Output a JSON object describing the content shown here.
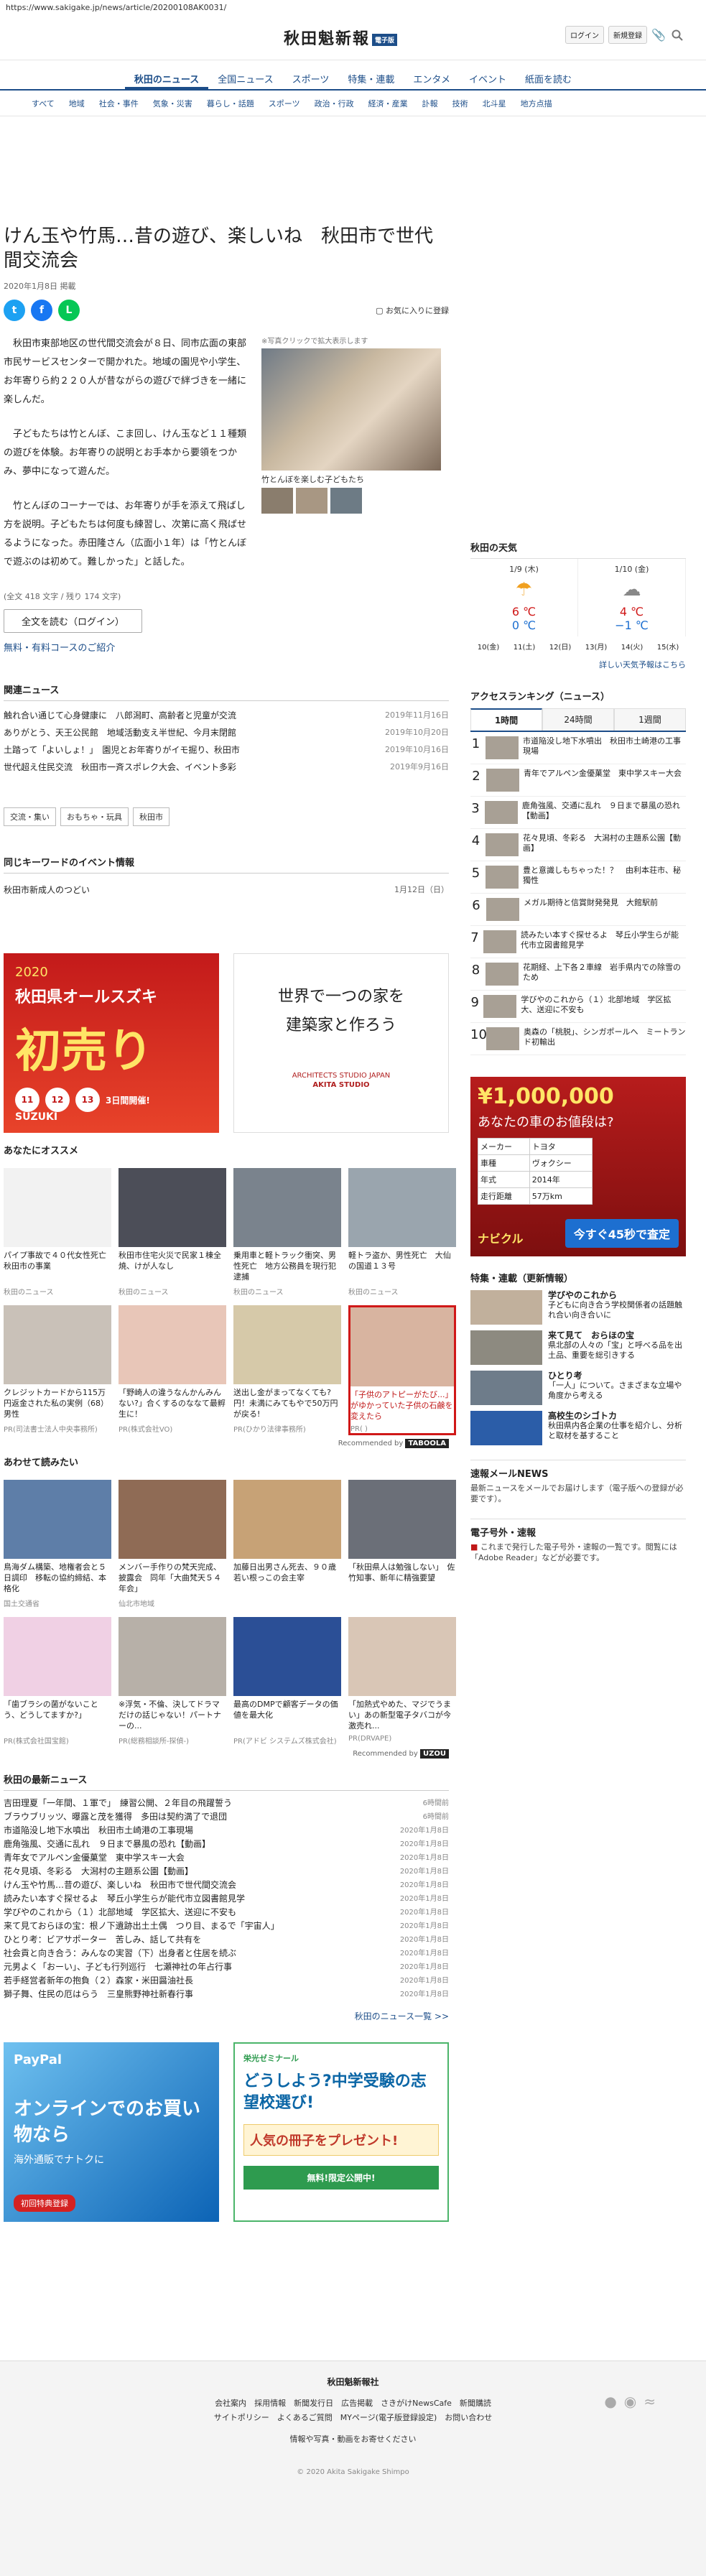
{
  "url": "https://www.sakigake.jp/news/article/20200108AK0031/",
  "header": {
    "logo": "秋田魁新報",
    "logo_badge": "電子版",
    "login": "ログイン",
    "register": "新規登録"
  },
  "nav_main": [
    "秋田のニュース",
    "全国ニュース",
    "スポーツ",
    "特集・連載",
    "エンタメ",
    "イベント",
    "紙面を読む"
  ],
  "nav_sub": [
    "すべて",
    "地域",
    "社会・事件",
    "気象・災害",
    "暮らし・話題",
    "スポーツ",
    "政治・行政",
    "経済・産業",
    "訃報",
    "技術",
    "北斗星",
    "地方点描"
  ],
  "article": {
    "title": "けん玉や竹馬…昔の遊び、楽しいね　秋田市で世代間交流会",
    "date": "2020年1月8日 掲載",
    "favorite": "お気に入りに登録",
    "photo_hint": "※写真クリックで拡大表示します",
    "photo_caption": "竹とんぼを楽しむ子どもたち",
    "paragraphs": [
      "秋田市東部地区の世代間交流会が８日、同市広面の東部市民サービスセンターで開かれた。地域の園児や小学生、お年寄りら約２２０人が昔ながらの遊びで絆づきを一緒に楽しんだ。",
      "子どもたちは竹とんぼ、こま回し、けん玉など１１種類の遊びを体験。お年寄りの説明とお手本から要領をつかみ、夢中になって遊んだ。",
      "竹とんぼのコーナーでは、お年寄りが手を添えて飛ばし方を説明。子どもたちは何度も練習し、次第に高く飛ばせるようになった。赤田隆さん（広面小１年）は「竹とんぼで遊ぶのは初めて。難しかった」と話した。"
    ],
    "word_count": "(全文 418 文字 / 残り 174 文字)",
    "read_full": "全文を読む（ログイン）",
    "course_link": "無料・有料コースのご紹介"
  },
  "related": {
    "title": "関連ニュース",
    "items": [
      {
        "text": "触れ合い通じて心身健康に　八郎潟町、高齢者と児童が交流",
        "date": "2019年11月16日"
      },
      {
        "text": "ありがとう、天王公民館　地域活動支え半世紀、今月末閉館",
        "date": "2019年10月20日"
      },
      {
        "text": "土踏って「よいしょ！」　園児とお年寄りがイモ掘り、秋田市",
        "date": "2019年10月16日"
      },
      {
        "text": "世代超え住民交流　秋田市一斉スポレク大会、イベント多彩",
        "date": "2019年9月16日"
      }
    ],
    "tags": [
      "交流・集い",
      "おもちゃ・玩具",
      "秋田市"
    ]
  },
  "events": {
    "title": "同じキーワードのイベント情報",
    "item": "秋田市新成人のつどい",
    "date": "1月12日（日）"
  },
  "ads_top": {
    "red_year": "2020",
    "red_store": "秋田県オールスズキ",
    "red_main": "初売り",
    "red_dates": [
      "11",
      "12",
      "13"
    ],
    "red_tail": "3日間開催!",
    "red_brand": "SUZUKI",
    "arch_line1": "世界で一つの家を",
    "arch_line2": "建築家と作ろう",
    "arch_brand": "ARCHITECTS STUDIO JAPAN",
    "arch_brand2": "AKITA STUDIO"
  },
  "reco": {
    "title": "あなたにオススメ",
    "cards": [
      {
        "text": "パイプ事故で４０代女性死亡　秋田市の事業",
        "src": "秋田のニュース"
      },
      {
        "text": "秋田市住宅火災で民家１棟全焼、けが人なし",
        "src": "秋田のニュース"
      },
      {
        "text": "乗用車と軽トラック衝突、男性死亡　地方公務員を現行犯逮捕",
        "src": "秋田のニュース"
      },
      {
        "text": "軽トラ盗か、男性死亡　大仙の国道１３号",
        "src": "秋田のニュース"
      },
      {
        "text": "クレジットカードから115万円返金された私の実例（68）男性",
        "src": "PR(司法書士法人中央事務所)"
      },
      {
        "text": "「野崎人の違うなんかんみんない?」合くするのななて最孵生に！",
        "src": "PR(株式会社VO)"
      },
      {
        "text": "送出し金がまってなくても?円！未満にみてもやで50万円が戻る!",
        "src": "PR(ひかり法律事務所)"
      },
      {
        "text": "「子供のアトピーがたび...」がゆかっていた子供の石鹸を変えたら",
        "src": "PR(              )"
      }
    ],
    "recommended_by": "Recommended by",
    "recommended_brand": "TABOOLA"
  },
  "also_read": {
    "title": "あわせて読みたい",
    "cards": [
      {
        "text": "鳥海ダム構築、地権者会と５日調印　移転の協約締結、本格化",
        "src": "国土交通省"
      },
      {
        "text": "メンバー手作りの梵天完成、披露会　同年「大曲梵天５４年会」",
        "src": "仙北市地域"
      },
      {
        "text": "加藤日出男さん死去、９０歳　若い根っこの会主宰",
        "src": ""
      },
      {
        "text": "「秋田県人は勉強しない」　佐竹知事、新年に精強要望",
        "src": ""
      },
      {
        "text": "「歯ブラシの菌がないことう、どうしてますか?」",
        "src": "PR(株式会社国宝館)"
      },
      {
        "text": "※浮気・不倫、決してドラマだけの話じゃない！パートナーの...",
        "src": "PR(総務相談所-探偵-)"
      },
      {
        "text": "最高のDMPで顧客データの価値を最大化",
        "src": "PR(アドビ システムズ株式会社)"
      },
      {
        "text": "「加熱式やめた、マジでうまい」あの新型電子タバコが今激売れ...",
        "src": "PR(DRVAPE)"
      }
    ],
    "recommended_by": "Recommended by",
    "recommended_brand": "UZOU"
  },
  "latest": {
    "title": "秋田の最新ニュース",
    "items": [
      {
        "text": "吉田理夏「一年間、１軍で」　練習公開、２年目の飛躍誓う",
        "date": "6時間前"
      },
      {
        "text": "ブラウブリッツ、曝露と茂を獲得　多田は契約満了で退団",
        "date": "6時間前"
      },
      {
        "text": "市道陥没し地下水噴出　秋田市土崎港の工事現場",
        "date": "2020年1月8日"
      },
      {
        "text": "鹿角強風、交通に乱れ　９日まで暴風の恐れ【動画】",
        "date": "2020年1月8日"
      },
      {
        "text": "青年女でアルペン金優菓堂　東中学スキー大会",
        "date": "2020年1月8日"
      },
      {
        "text": "花々見頃、冬彩る　大潟村の主題系公園【動画】",
        "date": "2020年1月8日"
      },
      {
        "text": "けん玉や竹馬…昔の遊び、楽しいね　秋田市で世代間交流会",
        "date": "2020年1月8日"
      },
      {
        "text": "読みたい本すぐ探せるよ　琴丘小学生らが能代市立図書館見学",
        "date": "2020年1月8日"
      },
      {
        "text": "学びやのこれから（１）北部地域　学区拡大、送迎に不安も",
        "date": "2020年1月8日"
      },
      {
        "text": "来て見ておらほの宝：根ノ下遺跡出土土偶　つり目、まるで「宇宙人」",
        "date": "2020年1月8日"
      },
      {
        "text": "ひとり考：ビアサポーター　苦しみ、話して共有を",
        "date": "2020年1月8日"
      },
      {
        "text": "社会貢と向き合う：みんなの実習（下）出身者と住居を続ぶ",
        "date": "2020年1月8日"
      },
      {
        "text": "元男よく「おーい」、子ども行列巡行　七瀬神社の年占行事",
        "date": "2020年1月8日"
      },
      {
        "text": "若手経営者新年の抱負（２）森家・米田醤油社長",
        "date": "2020年1月8日"
      },
      {
        "text": "獅子舞、住民の厄はらう　三皇熊野神社新春行事",
        "date": "2020年1月8日"
      }
    ],
    "more": "秋田のニュース一覧 >>"
  },
  "ads_bottom": {
    "paypal": "PayPal",
    "paypal_main": "オンラインでのお買い物なら",
    "paypal_sub": "海外通販でナトクに",
    "paypal_chip": "初回特典登録",
    "exam_brand": "栄光ゼミナール",
    "exam_head": "どうしよう?中学受験の志望校選び!",
    "exam_gift": "人気の冊子をプレゼント!",
    "exam_foot": "無料!限定公開中!"
  },
  "weather": {
    "title": "秋田の天気",
    "days": [
      {
        "date": "1/9 (木)",
        "icon": "☂",
        "hi": "6 ℃",
        "lo": "0 ℃"
      },
      {
        "date": "1/10 (金)",
        "icon": "☁",
        "hi": "4 ℃",
        "lo": "−1 ℃"
      }
    ],
    "week": [
      "10(金)",
      "11(土)",
      "12(日)",
      "13(月)",
      "14(火)",
      "15(水)"
    ],
    "link": "詳しい天気予報はこちら"
  },
  "ranking": {
    "title": "アクセスランキング（ニュース）",
    "tabs": [
      "1時間",
      "24時間",
      "1週間"
    ],
    "items": [
      "市道陥没し地下水噴出　秋田市土崎港の工事現場",
      "青年でアルペン金優菓堂　東中学スキー大会",
      "鹿角強風、交通に乱れ　９日まで暴風の恐れ【動画】",
      "花々見頃、冬彩る　大潟村の主題系公園【動画】",
      "豊と意識しもちゃった！？　由利本荘市、秘獨性",
      "メガル期待と信賞財発発見　大館駅前",
      "読みたい本すぐ探せるよ　琴丘小学生らが能代市立図書館見学",
      "花期経、上下各２車線　岩手県内での除雪のため",
      "学びやのこれから（１）北部地域　学区拡大、送迎に不安も",
      "奥森の「桃脱」、シンガポールへ　ミートランド初輸出"
    ]
  },
  "ad_car": {
    "amount": "¥1,000,000",
    "question": "あなたの車のお値段は?",
    "rows": [
      [
        "メーカー",
        "トヨタ"
      ],
      [
        "車種",
        "ヴォクシー"
      ],
      [
        "年式",
        "2014年"
      ],
      [
        "走行距離",
        "57万km"
      ]
    ],
    "brand": "ナビクル",
    "cta": "今すぐ45秒で査定"
  },
  "features": {
    "title": "特集・連載（更新情報）",
    "items": [
      {
        "head": "学びやのこれから",
        "text": "子どもに向き合う学校関係者の話題触れ合い向き合いに"
      },
      {
        "head": "来て見て　おらほの宝",
        "text": "県北部の人々の「宝」と呼べる品を出土品、重要を総引きする"
      },
      {
        "head": "ひとり考",
        "text": "「一人」について。さまざまな立場や角度から考える"
      },
      {
        "head": "高校生のシゴトカ",
        "text": "秋田県内各企業の仕事を紹介し、分析と取材を基すること"
      }
    ]
  },
  "mail_news": {
    "title": "速報メールNEWS",
    "text": "最新ニュースをメールでお届けします（電子版への登録が必要です）。"
  },
  "pdf_edition": {
    "title": "電子号外・速報",
    "text": "これまで発行した電子号外・速報の一覧です。閲覧には「Adobe Reader」などが必要です。"
  },
  "footer": {
    "name": "秋田魁新報社",
    "links1": "会社案内　採用情報　新聞发行日　広告掲載　さきがけNewsCafe　新聞購読",
    "links2": "サイトポリシー　よくあるご質問　MYページ(電子版登録設定)　お問い合わせ",
    "links3": "情報や写真・動画をお寄せください",
    "copy": "© 2020 Akita Sakigake Shimpo"
  }
}
